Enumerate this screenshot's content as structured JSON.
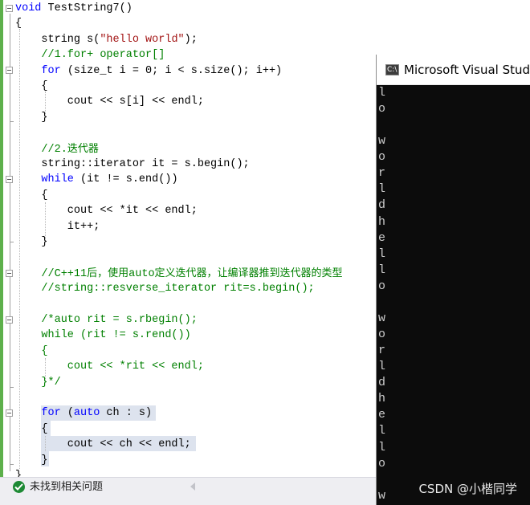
{
  "editor": {
    "lines": [
      [
        {
          "t": "void",
          "c": "kw"
        },
        {
          "t": " TestString7()",
          "c": ""
        }
      ],
      [
        {
          "t": "{",
          "c": ""
        }
      ],
      [
        {
          "t": "    string s(",
          "c": ""
        },
        {
          "t": "\"hello world\"",
          "c": "str"
        },
        {
          "t": ");",
          "c": ""
        }
      ],
      [
        {
          "t": "    //1.for+ operator[]",
          "c": "cm"
        }
      ],
      [
        {
          "t": "    ",
          "c": ""
        },
        {
          "t": "for",
          "c": "kw"
        },
        {
          "t": " (size_t i = 0; i < s.size(); i++)",
          "c": ""
        }
      ],
      [
        {
          "t": "    {",
          "c": ""
        }
      ],
      [
        {
          "t": "        cout << s[i] << endl;",
          "c": ""
        }
      ],
      [
        {
          "t": "    }",
          "c": ""
        }
      ],
      [
        {
          "t": "",
          "c": ""
        }
      ],
      [
        {
          "t": "    //2.",
          "c": "cm"
        },
        {
          "t": "迭代器",
          "c": "cm cjk"
        }
      ],
      [
        {
          "t": "    string::iterator it = s.begin();",
          "c": ""
        }
      ],
      [
        {
          "t": "    ",
          "c": ""
        },
        {
          "t": "while",
          "c": "kw"
        },
        {
          "t": " (it != s.end())",
          "c": ""
        }
      ],
      [
        {
          "t": "    {",
          "c": ""
        }
      ],
      [
        {
          "t": "        cout << *it << endl;",
          "c": ""
        }
      ],
      [
        {
          "t": "        it++;",
          "c": ""
        }
      ],
      [
        {
          "t": "    }",
          "c": ""
        }
      ],
      [
        {
          "t": "",
          "c": ""
        }
      ],
      [
        {
          "t": "    //C++11",
          "c": "cm"
        },
        {
          "t": "后，使用",
          "c": "cm cjk"
        },
        {
          "t": "auto",
          "c": "cm"
        },
        {
          "t": "定义迭代器，让编译器推到迭代器的类型",
          "c": "cm cjk"
        }
      ],
      [
        {
          "t": "    //string::resverse_iterator rit=s.begin();",
          "c": "cm"
        }
      ],
      [
        {
          "t": "",
          "c": ""
        }
      ],
      [
        {
          "t": "    /*auto rit = s.rbegin();",
          "c": "cm"
        }
      ],
      [
        {
          "t": "    while (rit != s.rend())",
          "c": "cm"
        }
      ],
      [
        {
          "t": "    {",
          "c": "cm"
        }
      ],
      [
        {
          "t": "        cout << *rit << endl;",
          "c": "cm"
        }
      ],
      [
        {
          "t": "    }*/",
          "c": "cm"
        }
      ],
      [
        {
          "t": "",
          "c": ""
        }
      ],
      [
        {
          "t": "    ",
          "c": ""
        },
        {
          "t": "for",
          "c": "kw"
        },
        {
          "t": " (",
          "c": ""
        },
        {
          "t": "auto",
          "c": "kw"
        },
        {
          "t": " ch : s)",
          "c": ""
        }
      ],
      [
        {
          "t": "    {",
          "c": ""
        }
      ],
      [
        {
          "t": "        cout << ch << endl;",
          "c": ""
        }
      ],
      [
        {
          "t": "    }",
          "c": ""
        }
      ],
      [
        {
          "t": "}",
          "c": ""
        }
      ]
    ]
  },
  "status": {
    "message": "未找到相关问题"
  },
  "console": {
    "title": "Microsoft Visual Studio",
    "icon_label": "C:\\",
    "output": [
      "l",
      "o",
      " ",
      "w",
      "o",
      "r",
      "l",
      "d",
      "h",
      "e",
      "l",
      "l",
      "o",
      " ",
      "w",
      "o",
      "r",
      "l",
      "d",
      "h",
      "e",
      "l",
      "l",
      "o",
      " ",
      "w"
    ]
  },
  "watermark": "CSDN @小楷同学"
}
